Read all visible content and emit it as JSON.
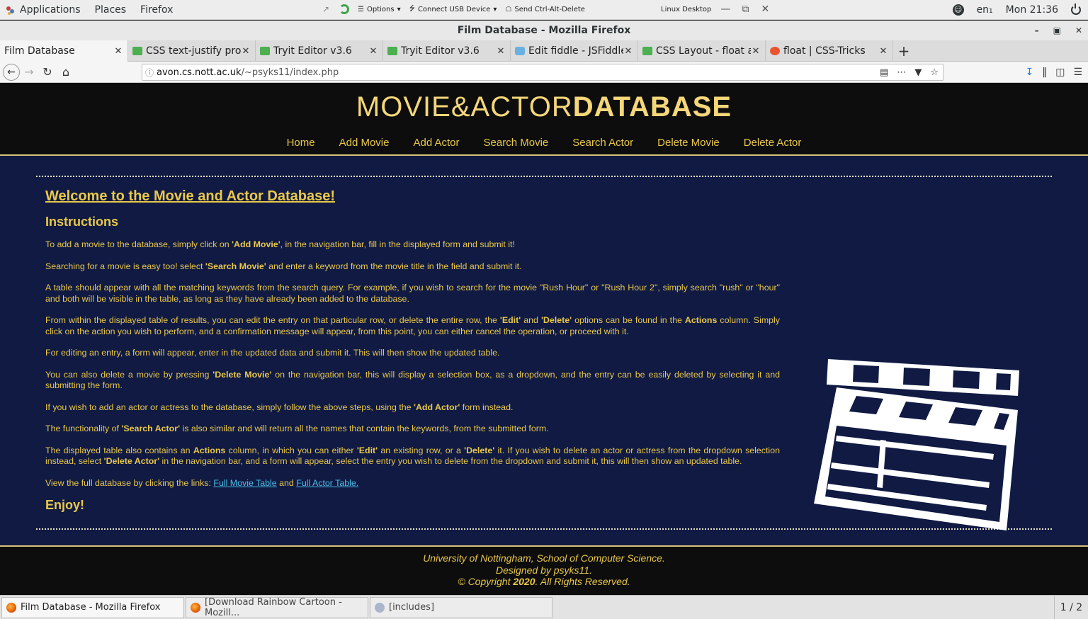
{
  "top_panel": {
    "applications": "Applications",
    "places": "Places",
    "firefox": "Firefox",
    "vnc_options": "Options",
    "vnc_usb": "Connect USB Device",
    "vnc_send": "Send Ctrl-Alt-Delete",
    "linux_desktop": "Linux Desktop",
    "lang": "en₁",
    "clock": "Mon 21:36"
  },
  "window": {
    "title": "Film Database - Mozilla Firefox"
  },
  "tabs": [
    {
      "label": "Film Database",
      "icon": "none"
    },
    {
      "label": "CSS text-justify property",
      "icon": "w3schools-icon"
    },
    {
      "label": "Tryit Editor v3.6",
      "icon": "w3schools-icon"
    },
    {
      "label": "Tryit Editor v3.6",
      "icon": "w3schools-icon"
    },
    {
      "label": "Edit fiddle - JSFiddle",
      "icon": "jsfiddle-icon"
    },
    {
      "label": "CSS Layout - float and clear",
      "icon": "w3schools-icon"
    },
    {
      "label": "float | CSS-Tricks",
      "icon": "csstricks-icon"
    }
  ],
  "url": {
    "host": "avon.cs.nott.ac.uk",
    "path": "/~psyks11/index.php"
  },
  "site": {
    "logo_thin": "MOVIE&ACTOR",
    "logo_bold": "DATABASE",
    "nav": [
      "Home",
      "Add Movie",
      "Add Actor",
      "Search Movie",
      "Search Actor",
      "Delete Movie",
      "Delete Actor"
    ],
    "heading": "Welcome to the Movie and Actor Database!",
    "subheading": "Instructions",
    "paragraphs": {
      "p1_a": "To add a movie to the database, simply click on ",
      "p1_b": "'Add Movie'",
      "p1_c": ", in the navigation bar, fill in the displayed form and submit it!",
      "p2_a": "Searching for a movie is easy too! select ",
      "p2_b": "'Search Movie'",
      "p2_c": " and enter a keyword from the movie title in the field and submit it.",
      "p3": "A table should appear with all the matching keywords from the search query. For example, if you wish to search for the movie \"Rush Hour\" or \"Rush Hour 2\", simply search \"rush\" or \"hour\" and both will be visible in the table, as long as they have already been added to the database.",
      "p4_a": "From within the displayed table of results, you can edit the entry on that particular row, or delete the entire row, the ",
      "p4_b": "'Edit'",
      "p4_c": " and ",
      "p4_d": "'Delete'",
      "p4_e": " options can be found in the ",
      "p4_f": "Actions",
      "p4_g": " column. Simply click on the action you wish to perform, and a confirmation message will appear, from this point, you can either cancel the operation, or proceed with it.",
      "p5": "For editing an entry, a form will appear, enter in the updated data and submit it. This will then show the updated table.",
      "p6_a": "You can also delete a movie by pressing ",
      "p6_b": "'Delete Movie'",
      "p6_c": " on the navigation bar, this will display a selection box, as a dropdown, and the entry can be easily deleted by selecting it and submitting the form.",
      "p7_a": "If you wish to add an actor or actress to the database, simply follow the above steps, using the ",
      "p7_b": "'Add Actor'",
      "p7_c": " form instead.",
      "p8_a": "The functionality of ",
      "p8_b": "'Search Actor'",
      "p8_c": " is also similar and will return all the names that contain the keywords, from the submitted form.",
      "p9_a": "The displayed table also contains an ",
      "p9_b": "Actions",
      "p9_c": " column, in which you can either ",
      "p9_d": "'Edit'",
      "p9_e": " an existing row, or a ",
      "p9_f": "'Delete'",
      "p9_g": " it. If you wish to delete an actor or actress from the dropdown selection instead, select ",
      "p9_h": "'Delete Actor'",
      "p9_i": " in the navigation bar, and a form will appear, select the entry you wish to delete from the dropdown and submit it, this will then show an updated table.",
      "p10_a": "View the full database by clicking the links: ",
      "p10_link1": "Full Movie Table",
      "p10_b": " and ",
      "p10_link2": "Full Actor Table.",
      "enjoy": "Enjoy!"
    },
    "footer": {
      "line1": "University of Nottingham, School of Computer Science.",
      "line2": "Designed by psyks11.",
      "line3_a": "© Copyright ",
      "line3_b": "2020",
      "line3_c": ". All Rights Reserved."
    }
  },
  "taskbar": {
    "items": [
      "Film Database - Mozilla Firefox",
      "[Download Rainbow Cartoon - Mozill...",
      "[includes]"
    ],
    "pager": "1 / 2"
  },
  "colors": {
    "page_bg": "#101a43",
    "gold": "#e9c84a",
    "link": "#4cc0e8",
    "header_bg": "#0d0d0d"
  }
}
